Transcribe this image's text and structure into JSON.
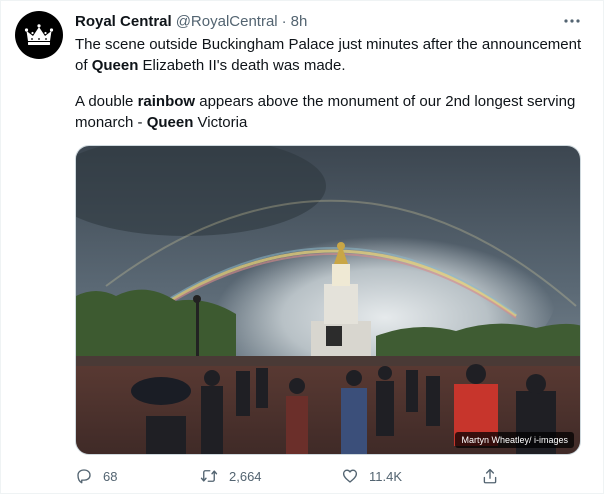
{
  "tweet": {
    "display_name": "Royal Central",
    "handle": "@RoyalCentral",
    "separator": "·",
    "time": "8h",
    "text": {
      "p1_a": "The scene outside Buckingham Palace just minutes after the announcement of ",
      "p1_b": "Queen",
      "p1_c": " Elizabeth II's death was made.",
      "p2_a": "A double ",
      "p2_b": "rainbow",
      "p2_c": " appears above the monument of our 2nd longest serving monarch - ",
      "p2_d": "Queen",
      "p2_e": " Victoria"
    },
    "photo_credit": "Martyn Wheatley/ i-images"
  },
  "actions": {
    "reply_count": "68",
    "retweet_count": "2,664",
    "like_count": "11.4K"
  },
  "icons": {
    "avatar": "crown-icon",
    "more": "more-icon",
    "reply": "reply-icon",
    "retweet": "retweet-icon",
    "like": "heart-icon",
    "share": "share-icon"
  },
  "colors": {
    "text_primary": "#0f1419",
    "text_secondary": "#536471",
    "avatar_bg": "#000000"
  }
}
